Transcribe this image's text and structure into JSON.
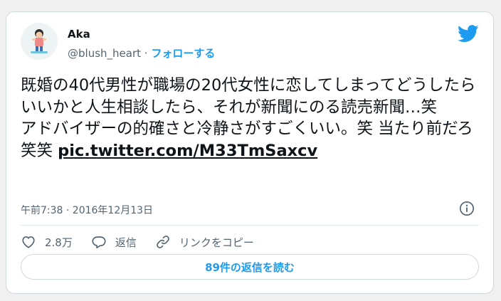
{
  "tweet": {
    "author": {
      "display_name": "Aka",
      "handle": "@blush_heart",
      "separator": " · ",
      "follow_label": "フォローする"
    },
    "text": "既婚の40代男性が職場の20代女性に恋してしまってどうしたらいいかと人生相談したら、それが新聞にのる読売新聞…笑\nアドバイザーの的確さと冷静さがすごくいい。笑 当たり前だろ笑笑 ",
    "link_text": "pic.twitter.com/M33TmSaxcv",
    "timestamp": "午前7:38 · 2016年12月13日",
    "actions": {
      "like_count": "2.8万",
      "reply_label": "返信",
      "copy_link_label": "リンクをコピー"
    },
    "read_replies_label": "89件の返信を読む"
  },
  "colors": {
    "accent": "#1d9bf0",
    "text_primary": "#0f1419",
    "text_secondary": "#536471",
    "border": "#cfd9de"
  },
  "icons": {
    "brand": "twitter-bird-icon",
    "info": "info-icon",
    "like": "heart-icon",
    "reply": "speech-bubble-icon",
    "copy_link": "link-icon"
  }
}
